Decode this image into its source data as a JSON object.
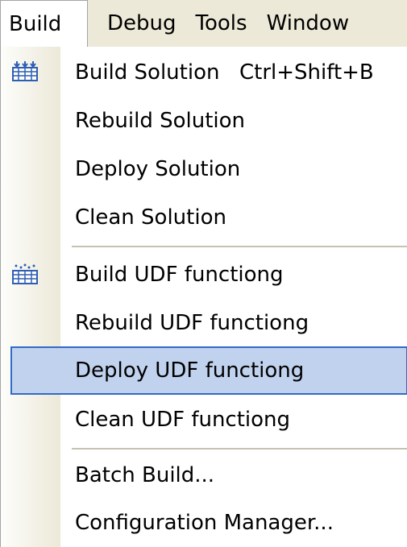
{
  "menubar": {
    "items": [
      {
        "label": "Build"
      },
      {
        "label": "Debug"
      },
      {
        "label": "Tools"
      },
      {
        "label": "Window"
      }
    ]
  },
  "menu": {
    "items": [
      {
        "label": "Build Solution",
        "shortcut": "Ctrl+Shift+B",
        "icon": "build-solution-icon"
      },
      {
        "label": "Rebuild Solution"
      },
      {
        "label": "Deploy Solution"
      },
      {
        "label": "Clean Solution"
      },
      {
        "label": "Build UDF functiong",
        "icon": "build-project-icon"
      },
      {
        "label": "Rebuild UDF functiong"
      },
      {
        "label": "Deploy UDF functiong",
        "highlighted": true
      },
      {
        "label": "Clean UDF functiong"
      },
      {
        "label": "Batch Build..."
      },
      {
        "label": "Configuration Manager..."
      }
    ]
  },
  "colors": {
    "menubar_bg": "#ece9d8",
    "highlight_bg": "#c1d2ee",
    "highlight_border": "#316ac5",
    "icon_blue": "#2f5fb3"
  }
}
